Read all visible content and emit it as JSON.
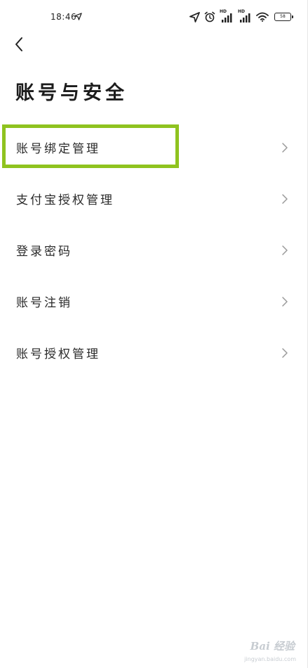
{
  "status_bar": {
    "time": "18:46",
    "hd_label_1": "HD",
    "hd_label_2": "HD",
    "battery_level": "58"
  },
  "header": {
    "title": "账号与安全"
  },
  "menu": {
    "items": [
      {
        "label": "账号绑定管理"
      },
      {
        "label": "支付宝授权管理"
      },
      {
        "label": "登录密码"
      },
      {
        "label": "账号注销"
      },
      {
        "label": "账号授权管理"
      }
    ]
  },
  "annotation": {
    "highlight_color": "#8fc31f"
  },
  "watermark": {
    "brand": "Bai 经验",
    "url": "jingyan.baidu.com"
  },
  "icons": {
    "back": "chevron-left-icon",
    "item_arrow": "chevron-right-icon"
  }
}
